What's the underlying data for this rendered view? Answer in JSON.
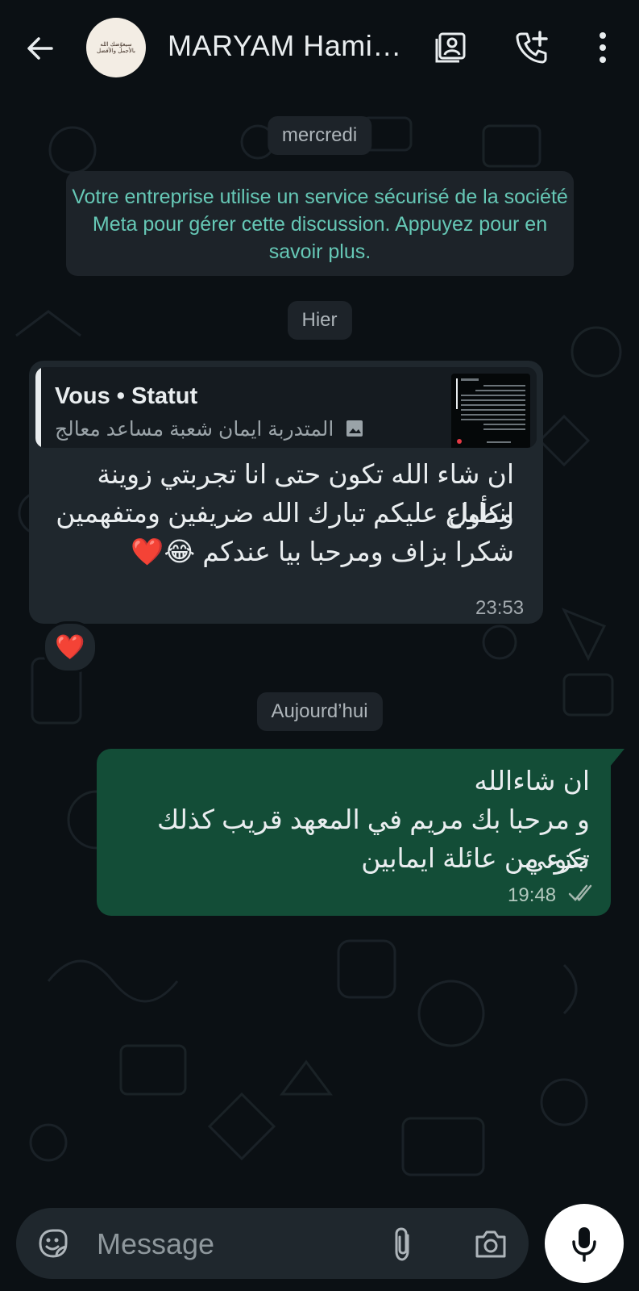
{
  "header": {
    "contact_name": "MARYAM Hami…",
    "avatar_text": "سيعوّضك الله بالأجمل والأفضل",
    "icons": {
      "back": "back-arrow-icon",
      "contact_card": "contact-card-icon",
      "add_call": "add-call-icon",
      "menu": "more-vert-icon"
    }
  },
  "chat": {
    "date_wed": "mercredi",
    "notice": "Votre entreprise utilise un service sécurisé de la société Meta pour gérer cette discussion. Appuyez pour en savoir plus.",
    "date_yesterday": "Hier",
    "incoming": {
      "quote_title": "Vous • Statut",
      "quote_subtitle": "المتدربة ايمان شعبة مساعد معالج",
      "line1": "ان شاء الله تكون حتى انا تجربتي زوينة وكأول",
      "line2": "انطباع عليكم تبارك الله ضريفين ومتفهمين",
      "line3": "شكرا بزاف ومرحبا بيا عندكم 😂❤️",
      "time": "23:53",
      "reaction": "❤️"
    },
    "date_today": "Aujourd’hui",
    "outgoing": {
      "line1": "ان شاءالله",
      "line2": "و مرحبا بك مريم في المعهد قريب كذلك تكوني",
      "line3": "جزء من عائلة ايمابين",
      "time": "19:48",
      "status_icon": "double-check-icon"
    }
  },
  "composer": {
    "placeholder": "Message",
    "icons": {
      "sticker": "sticker-icon",
      "attach": "attach-icon",
      "camera": "camera-icon",
      "mic": "mic-icon"
    }
  },
  "colors": {
    "bg": "#0b1014",
    "incoming": "#1f272d",
    "outgoing": "#134d37",
    "notice_text": "#66c8b6"
  }
}
